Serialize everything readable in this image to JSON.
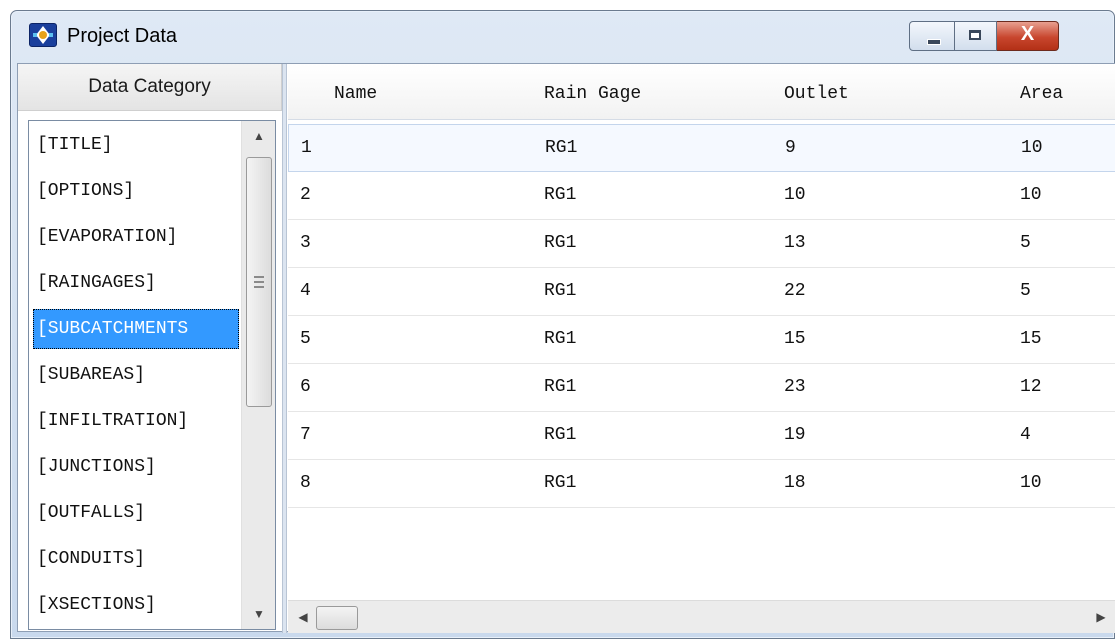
{
  "window": {
    "title": "Project Data",
    "close_symbol": "X",
    "icons": {
      "app": "app-logo-icon",
      "minimize": "minimize-icon",
      "maximize": "maximize-icon",
      "close": "close-icon"
    }
  },
  "category_panel": {
    "header": "Data Category",
    "items": [
      "[TITLE]",
      "[OPTIONS]",
      "[EVAPORATION]",
      "[RAINGAGES]",
      "[SUBCATCHMENTS",
      "[SUBAREAS]",
      "[INFILTRATION]",
      "[JUNCTIONS]",
      "[OUTFALLS]",
      "[CONDUITS]",
      "[XSECTIONS]"
    ],
    "selected_index": 4,
    "scroll_up_symbol": "▲",
    "scroll_down_symbol": "▼"
  },
  "grid": {
    "columns": [
      "Name",
      "Rain Gage",
      "Outlet",
      "Area"
    ],
    "rows": [
      [
        "1",
        "RG1",
        "9",
        "10"
      ],
      [
        "2",
        "RG1",
        "10",
        "10"
      ],
      [
        "3",
        "RG1",
        "13",
        "5"
      ],
      [
        "4",
        "RG1",
        "22",
        "5"
      ],
      [
        "5",
        "RG1",
        "15",
        "15"
      ],
      [
        "6",
        "RG1",
        "23",
        "12"
      ],
      [
        "7",
        "RG1",
        "19",
        "4"
      ],
      [
        "8",
        "RG1",
        "18",
        "10"
      ]
    ],
    "current_row_index": 0,
    "scroll_left_symbol": "◀",
    "scroll_right_symbol": "▶"
  },
  "colors": {
    "selection": "#3399ff",
    "title_bar": "#dfe9f5",
    "close_button": "#c8462e"
  }
}
